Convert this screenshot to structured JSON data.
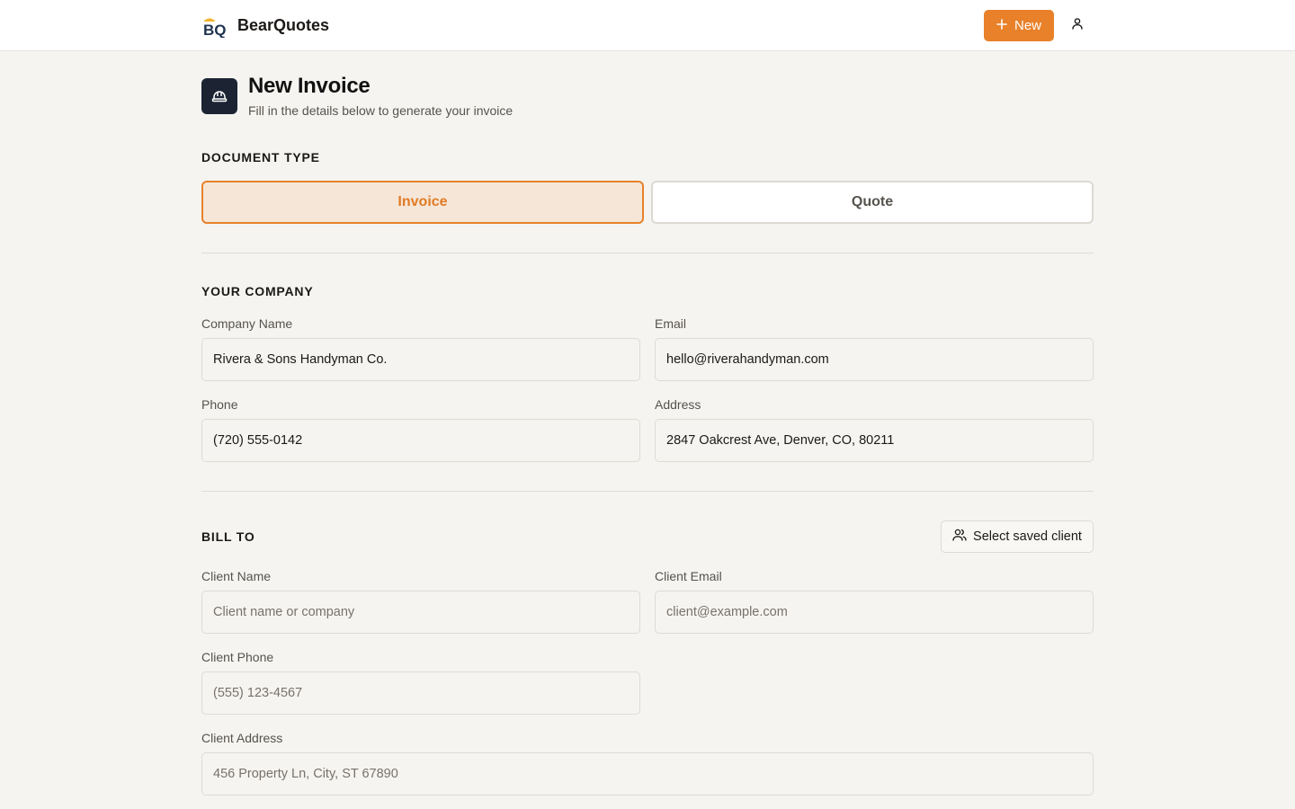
{
  "app": {
    "name": "BearQuotes",
    "logo_text": "BQ"
  },
  "topbar": {
    "new_label": "New"
  },
  "page": {
    "title": "New Invoice",
    "subtitle": "Fill in the details below to generate your invoice"
  },
  "document_type": {
    "heading": "DOCUMENT TYPE",
    "options": [
      "Invoice",
      "Quote"
    ],
    "selected": "Invoice"
  },
  "company": {
    "heading": "YOUR COMPANY",
    "fields": {
      "name": {
        "label": "Company Name",
        "value": "Rivera & Sons Handyman Co."
      },
      "email": {
        "label": "Email",
        "value": "hello@riverahandyman.com"
      },
      "phone": {
        "label": "Phone",
        "value": "(720) 555-0142"
      },
      "address": {
        "label": "Address",
        "value": "2847 Oakcrest Ave, Denver, CO, 80211"
      }
    }
  },
  "bill_to": {
    "heading": "BILL TO",
    "select_saved_label": "Select saved client",
    "fields": {
      "client_name": {
        "label": "Client Name",
        "placeholder": "Client name or company"
      },
      "client_email": {
        "label": "Client Email",
        "placeholder": "client@example.com"
      },
      "client_phone": {
        "label": "Client Phone",
        "placeholder": "(555) 123-4567"
      },
      "client_address": {
        "label": "Client Address",
        "placeholder": "456 Property Ln, City, ST 67890"
      }
    }
  },
  "colors": {
    "accent": "#e8812a",
    "accent_soft": "#f5e6d8",
    "dark": "#1c2433",
    "background": "#f5f4f1"
  },
  "icons": [
    "bearquotes-logo",
    "plus-icon",
    "user-icon",
    "hard-hat-icon",
    "users-icon"
  ]
}
